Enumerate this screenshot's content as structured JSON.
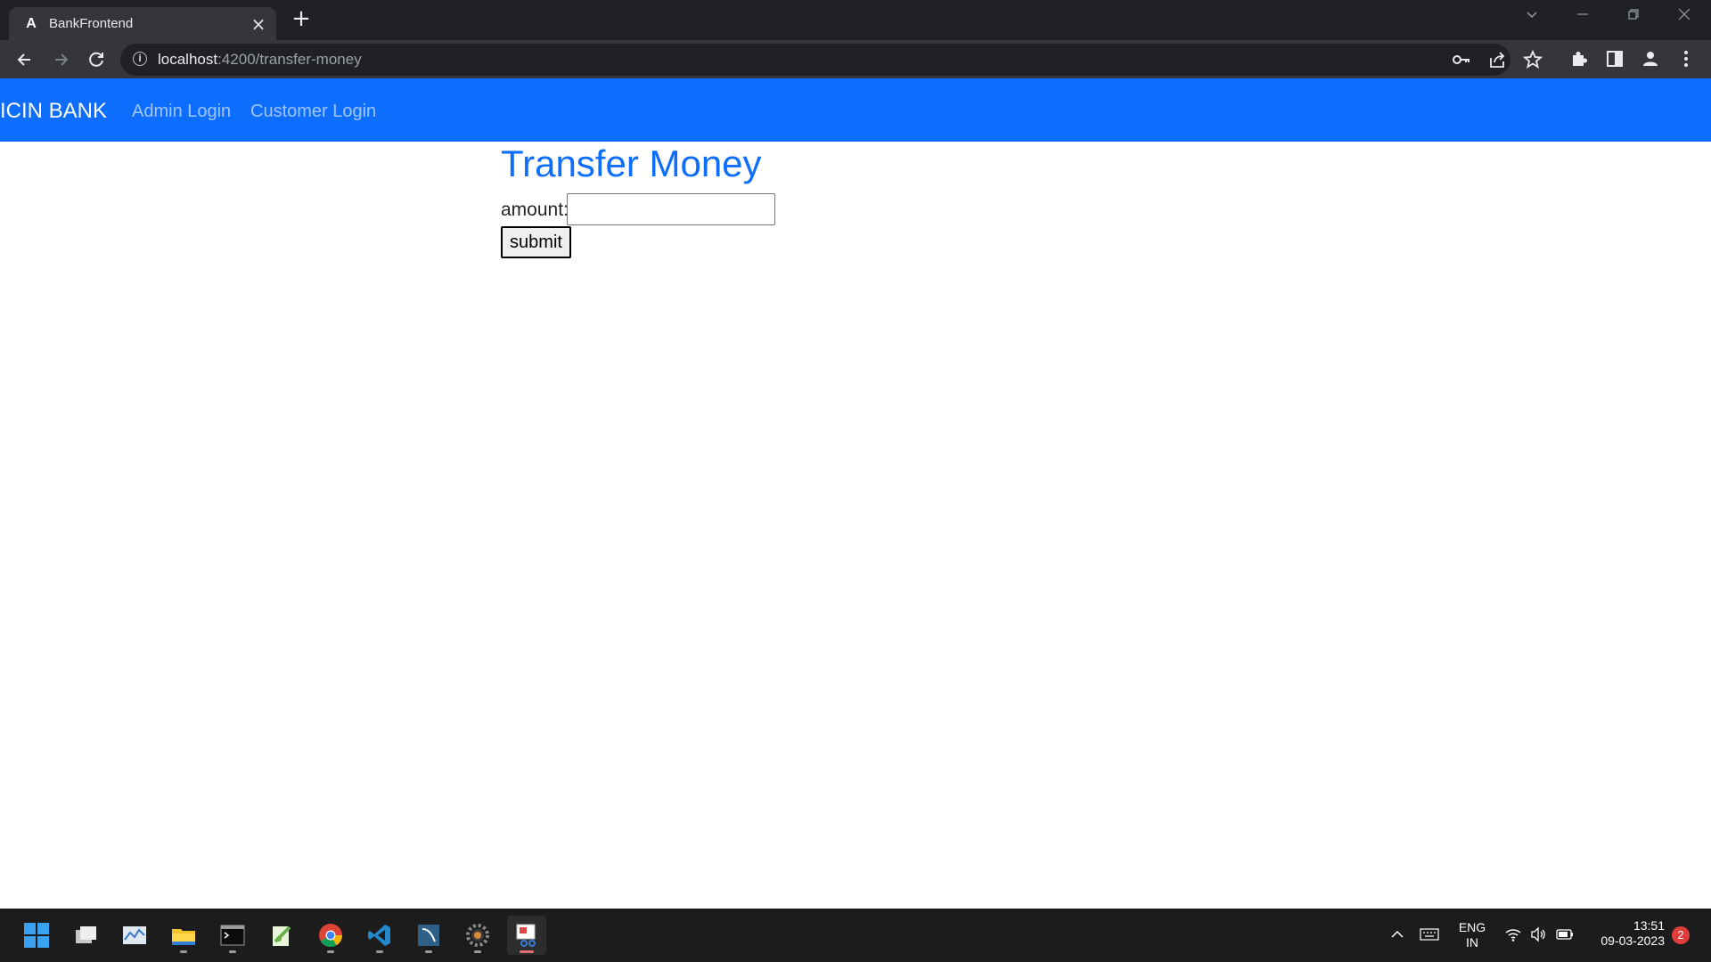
{
  "browser": {
    "tab_title": "BankFrontend",
    "tab_favicon": "A",
    "url_host": "localhost",
    "url_path": ":4200/transfer-money"
  },
  "navbar": {
    "brand": "ICIN BANK",
    "links": [
      "Admin Login",
      "Customer Login"
    ]
  },
  "page": {
    "title": "Transfer Money",
    "amount_label": "amount:",
    "amount_value": "",
    "submit_label": "submit"
  },
  "taskbar": {
    "language": "ENG",
    "region": "IN",
    "time": "13:51",
    "date": "09-03-2023",
    "notification_count": "2"
  },
  "colors": {
    "navbar_bg": "#0d6efd",
    "title_color": "#0d6efd",
    "chrome_dark": "#202124"
  }
}
